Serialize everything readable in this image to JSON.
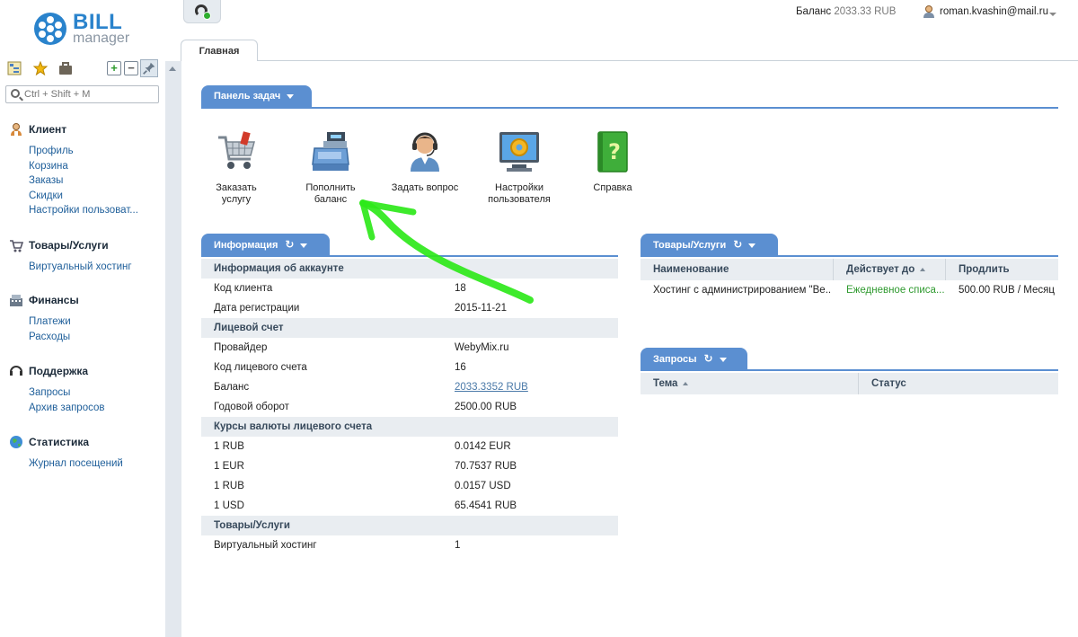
{
  "brand": {
    "bill": "BILL",
    "manager": "manager"
  },
  "header": {
    "balance_label": "Баланс",
    "balance_value": "2033.33 RUB",
    "username": "roman.kvashin@mail.ru"
  },
  "sidebar": {
    "search_placeholder": "Ctrl + Shift + M",
    "groups": [
      {
        "title": "Клиент",
        "icon": "client-icon",
        "items": [
          "Профиль",
          "Корзина",
          "Заказы",
          "Скидки",
          "Настройки пользоват..."
        ]
      },
      {
        "title": "Товары/Услуги",
        "icon": "cart-icon",
        "items": [
          "Виртуальный хостинг"
        ]
      },
      {
        "title": "Финансы",
        "icon": "finance-icon",
        "items": [
          "Платежи",
          "Расходы"
        ]
      },
      {
        "title": "Поддержка",
        "icon": "headset-icon",
        "items": [
          "Запросы",
          "Архив запросов"
        ]
      },
      {
        "title": "Статистика",
        "icon": "globe-icon",
        "items": [
          "Журнал посещений"
        ]
      }
    ]
  },
  "main_tab": "Главная",
  "task_panel": {
    "title": "Панель задач",
    "items": [
      {
        "line1": "Заказать",
        "line2": "услугу",
        "icon": "cart-icon"
      },
      {
        "line1": "Пополнить",
        "line2": "баланс",
        "icon": "cash-register-icon"
      },
      {
        "line1": "Задать вопрос",
        "line2": "",
        "icon": "support-agent-icon"
      },
      {
        "line1": "Настройки",
        "line2": "пользователя",
        "icon": "monitor-gear-icon"
      },
      {
        "line1": "Справка",
        "line2": "",
        "icon": "help-book-icon"
      }
    ]
  },
  "info_panel": {
    "title": "Информация",
    "sections": [
      {
        "title": "Информация об аккаунте",
        "rows": [
          [
            "Код клиента",
            "18"
          ],
          [
            "Дата регистрации",
            "2015-11-21"
          ]
        ]
      },
      {
        "title": "Лицевой счет",
        "rows": [
          [
            "Провайдер",
            "WebyMix.ru"
          ],
          [
            "Код лицевого счета",
            "16"
          ],
          [
            "Баланс",
            "2033.3352 RUB"
          ],
          [
            "Годовой оборот",
            "2500.00 RUB"
          ]
        ]
      },
      {
        "title": "Курсы валюты лицевого счета",
        "rows": [
          [
            "1 RUB",
            "0.0142 EUR"
          ],
          [
            "1 EUR",
            "70.7537 RUB"
          ],
          [
            "1 RUB",
            "0.0157 USD"
          ],
          [
            "1 USD",
            "65.4541 RUB"
          ]
        ]
      },
      {
        "title": "Товары/Услуги",
        "rows": [
          [
            "Виртуальный хостинг",
            "1"
          ]
        ]
      }
    ]
  },
  "services_panel": {
    "title": "Товары/Услуги",
    "columns": [
      "Наименование",
      "Действует до",
      "Продлить"
    ],
    "rows": [
      [
        "Хостинг с администрированием \"Ве...",
        "Ежедневное списа...",
        "500.00 RUB / Месяц"
      ]
    ]
  },
  "requests_panel": {
    "title": "Запросы",
    "columns": [
      "Тема",
      "Статус"
    ]
  },
  "colors": {
    "accent": "#5b8fd1",
    "brand": "#2a83cc",
    "link": "#1f5f9a",
    "annotation_arrow": "#2ee81a"
  }
}
